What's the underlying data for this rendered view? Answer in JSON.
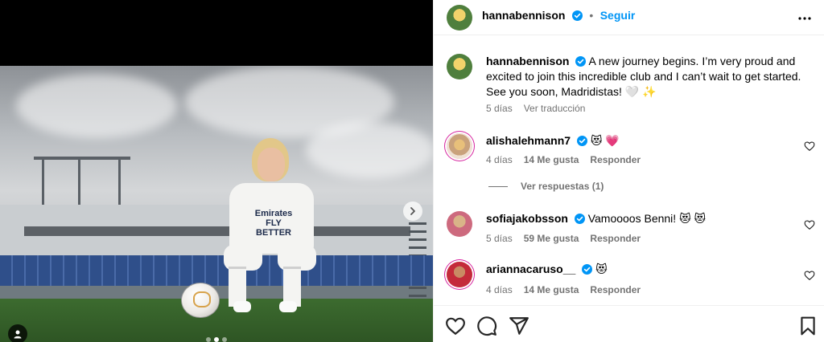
{
  "post": {
    "author": "hannabennison",
    "follow_label": "Seguir",
    "caption": "A new journey begins. I’m very proud and excited to join this incredible club and I can’t wait to get started. See you soon, Madridistas! 🤍 ✨",
    "caption_time": "5 días",
    "translate_label": "Ver traducción",
    "shirt_sponsor": "Emirates FLY BETTER"
  },
  "comments": [
    {
      "username": "alishalehmann7",
      "text": "😻 💗",
      "time": "4 días",
      "likes": "14 Me gusta",
      "reply_label": "Responder",
      "view_replies": "Ver respuestas (1)"
    },
    {
      "username": "sofiajakobsson",
      "text": "Vamoooos Benni! 😻 😻",
      "time": "5 días",
      "likes": "59 Me gusta",
      "reply_label": "Responder"
    },
    {
      "username": "ariannacaruso__",
      "text": "😻",
      "time": "4 días",
      "likes": "14 Me gusta",
      "reply_label": "Responder"
    }
  ],
  "colors": {
    "accent": "#0095f6",
    "verified": "#0095f6",
    "muted": "#737373"
  },
  "icons": [
    "verified-badge-icon",
    "more-options-icon",
    "heart-icon",
    "comment-icon",
    "share-icon",
    "bookmark-icon",
    "chevron-right-icon",
    "user-tag-icon"
  ],
  "carousel": {
    "slides": 3,
    "active_index": 1
  }
}
